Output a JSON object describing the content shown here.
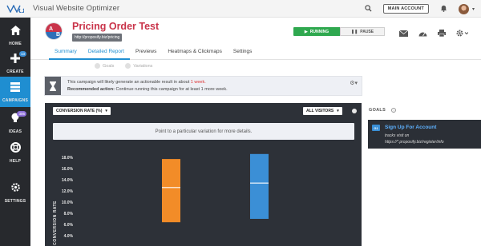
{
  "app": {
    "title": "Visual Website Optimizer",
    "main_account_label": "MAIN ACCOUNT"
  },
  "sidebar": {
    "items": [
      {
        "label": "HOME",
        "icon": "home-icon"
      },
      {
        "label": "CREATE",
        "icon": "plus-icon",
        "badge": "13"
      },
      {
        "label": "CAMPAIGNS",
        "icon": "campaigns-icon",
        "active": true
      },
      {
        "label": "IDEAS",
        "icon": "lightbulb-icon",
        "badge": "306"
      },
      {
        "label": "HELP",
        "icon": "lifebuoy-icon"
      },
      {
        "label": "SETTINGS",
        "icon": "gear-icon"
      }
    ]
  },
  "campaign": {
    "avatar_a": "A",
    "avatar_b": "B",
    "title": "Pricing Order Test",
    "url": "http://proposify.biz/pricing",
    "status_running": "RUNNING",
    "status_pause": "PAUSE"
  },
  "tabs": [
    {
      "label": "Summary",
      "active": true
    },
    {
      "label": "Detailed Report",
      "active": true
    },
    {
      "label": "Previews"
    },
    {
      "label": "Heatmaps & Clickmaps"
    },
    {
      "label": "Settings"
    }
  ],
  "sub_tabs": [
    "Goals",
    "Variations"
  ],
  "notice": {
    "line1_prefix": "This campaign will likely generate an actionable result in about ",
    "line1_highlight": "1 week.",
    "line2_label": "Recommended action:",
    "line2_text": " Continue running this campaign for at least 1 more week."
  },
  "chart_toolbar": {
    "metric_dropdown": "CONVERSION RATE (%)",
    "visitors_dropdown": "ALL VISITORS",
    "hint": "Point to a particular variation for more details."
  },
  "goals": {
    "label": "GOALS",
    "badge": "G1",
    "title": "Sign Up For Account",
    "line2": "tracks visit on",
    "line3": "https://*.proposify.biz/register/info"
  },
  "chart_data": {
    "type": "bar",
    "ylabel": "CONVERSION RATE",
    "y_ticks": [
      "18.0%",
      "16.0%",
      "14.0%",
      "12.0%",
      "10.0%",
      "8.0%",
      "6.0%",
      "4.0%"
    ],
    "ylim": [
      3.0,
      18.0
    ],
    "series": [
      {
        "low": 6.4,
        "high": 17.7,
        "mid": 12.6,
        "color": "#f28c28"
      },
      {
        "low": 7.0,
        "high": 18.6,
        "mid": 13.4,
        "color": "#3b8fd6"
      }
    ]
  },
  "colors": {
    "accent": "#1f8ed1",
    "brand_red": "#c9344a",
    "running": "#2fa84f"
  }
}
